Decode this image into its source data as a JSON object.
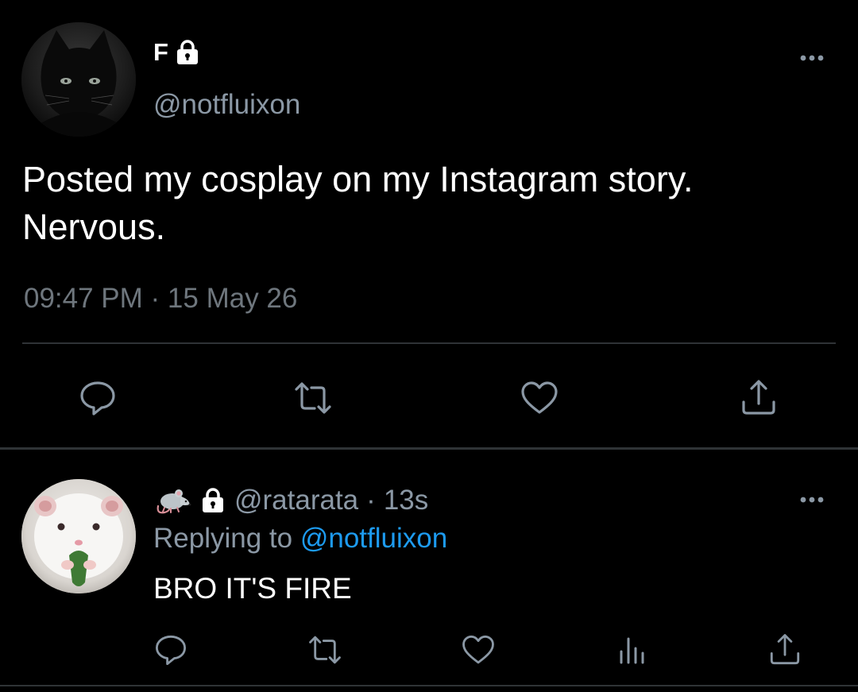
{
  "colors": {
    "background": "#000000",
    "text_primary": "#ffffff",
    "text_secondary": "#8b98a5",
    "accent_link": "#1d9bf0",
    "divider": "#2f3336"
  },
  "main_tweet": {
    "display_name": "F",
    "protected_icon": "lock-icon",
    "handle": "@notfluixon",
    "text": "Posted my cosplay on my Instagram story. Nervous.",
    "timestamp": "09:47 PM · 15 May 26",
    "actions": [
      "reply-icon",
      "retweet-icon",
      "like-icon",
      "share-icon"
    ]
  },
  "reply": {
    "display_name_emoji": "rat-icon",
    "protected_icon": "lock-icon",
    "handle": "@ratarata",
    "separator": "·",
    "time_ago": "13s",
    "replying_prefix": "Replying to",
    "replying_to": "@notfluixon",
    "text": "BRO IT'S FIRE",
    "actions": [
      "reply-icon",
      "retweet-icon",
      "like-icon",
      "analytics-icon",
      "share-icon"
    ]
  }
}
